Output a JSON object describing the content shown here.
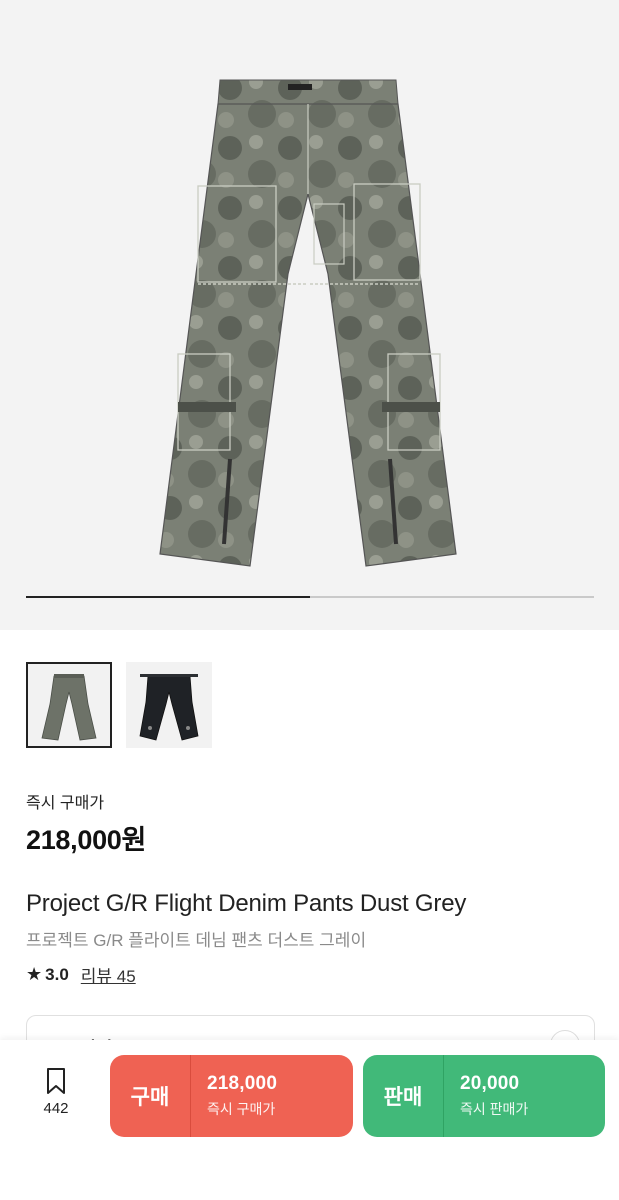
{
  "gallery": {
    "progress_fraction": 0.5,
    "thumbnails": [
      {
        "name": "grey-pants-thumbnail",
        "color": "#6d7268",
        "selected": true
      },
      {
        "name": "black-pants-thumbnail",
        "color": "#1f2226",
        "selected": false
      }
    ]
  },
  "price": {
    "label": "즉시 구매가",
    "value": "218,000원"
  },
  "product": {
    "title_en": "Project G/R Flight Denim Pants Dust Grey",
    "title_ko": "프로젝트 G/R 플라이트 데님 팬츠 더스트 그레이"
  },
  "rating": {
    "icon": "star-icon",
    "score": "3.0",
    "reviews": "리뷰 45"
  },
  "size_selector": {
    "label": "모든 사이즈"
  },
  "bottom_bar": {
    "bookmark_icon": "bookmark-icon",
    "bookmark_count": "442",
    "buy": {
      "label": "구매",
      "price": "218,000",
      "sub": "즉시 구매가",
      "color": "#ef6253"
    },
    "sell": {
      "label": "판매",
      "price": "20,000",
      "sub": "즉시 판매가",
      "color": "#41b979"
    }
  }
}
